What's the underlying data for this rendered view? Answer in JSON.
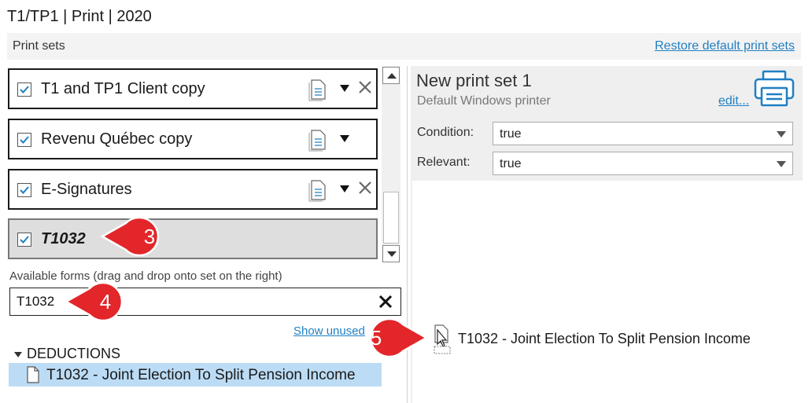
{
  "window": {
    "title": "T1/TP1 | Print | 2020"
  },
  "header": {
    "section_label": "Print sets",
    "restore_link": "Restore default print sets"
  },
  "print_sets": [
    {
      "label": "T1 and TP1 Client copy",
      "checked": true,
      "has_delete": true,
      "selected": false
    },
    {
      "label": "Revenu Québec copy",
      "checked": true,
      "has_delete": false,
      "selected": false
    },
    {
      "label": "E-Signatures",
      "checked": true,
      "has_delete": true,
      "selected": false
    },
    {
      "label": "T1032",
      "checked": true,
      "has_delete": false,
      "selected": true
    }
  ],
  "available_forms": {
    "label": "Available forms (drag and drop onto set on the right)",
    "search_value": "T1032",
    "show_unused_link": "Show unused",
    "group_label": "DEDUCTIONS",
    "items": [
      {
        "label": "T1032 - Joint Election To Split Pension Income"
      }
    ]
  },
  "detail": {
    "name": "New print set 1",
    "printer": "Default Windows printer",
    "edit_link": "edit...",
    "condition_label": "Condition:",
    "condition_value": "true",
    "relevant_label": "Relevant:",
    "relevant_value": "true",
    "drag_item_label": "T1032 - Joint Election To Split Pension Income"
  },
  "callouts": {
    "three": "3",
    "four": "4",
    "five": "5"
  },
  "colors": {
    "link": "#1f7fc4",
    "selection": "#bcdcf5",
    "callout": "#e2262a"
  }
}
